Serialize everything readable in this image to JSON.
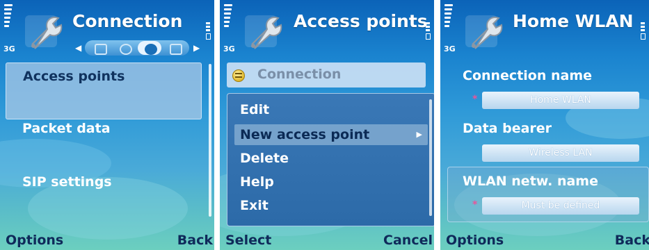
{
  "status": {
    "network": "3G"
  },
  "colors": {
    "bg_top": "#0b63b8",
    "bg_bottom": "#6ccfbf",
    "highlight": "#aac8e6",
    "softkey": "#0f2a5a",
    "required": "#e8559a"
  },
  "screen1": {
    "title": "Connection",
    "items": [
      "Access points",
      "Packet data",
      "SIP settings"
    ],
    "softkeys": {
      "left": "Options",
      "right": "Back"
    }
  },
  "screen2": {
    "title": "Access points",
    "list_item": "Connection",
    "menu": [
      "Edit",
      "New access point",
      "Delete",
      "Help",
      "Exit"
    ],
    "softkeys": {
      "left": "Select",
      "right": "Cancel"
    }
  },
  "screen3": {
    "title": "Home WLAN",
    "fields": [
      {
        "label": "Connection name",
        "value": "Home WLAN",
        "required": "*"
      },
      {
        "label": "Data bearer",
        "value": "Wireless LAN",
        "required": ""
      },
      {
        "label": "WLAN netw. name",
        "value": "Must be defined",
        "required": "*"
      }
    ],
    "softkeys": {
      "left": "Options",
      "right": "Back"
    }
  }
}
